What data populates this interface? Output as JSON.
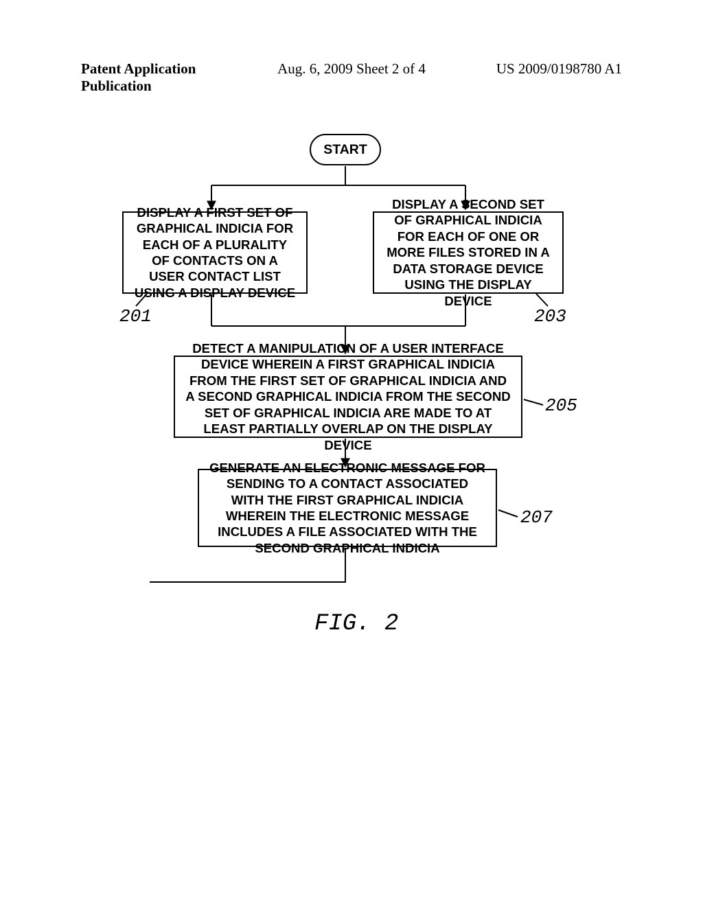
{
  "header": {
    "left": "Patent Application Publication",
    "mid_prefix": "Aug. 6, 2009   Sheet 2 of 4",
    "right": "US 2009/0198780 A1"
  },
  "start": {
    "label": "START"
  },
  "boxes": {
    "b201": "DISPLAY A FIRST SET OF GRAPHICAL INDICIA FOR EACH OF A PLURALITY OF CONTACTS ON A USER CONTACT LIST USING A DISPLAY DEVICE",
    "b203": "DISPLAY A SECOND SET OF GRAPHICAL INDICIA FOR EACH OF ONE OR MORE FILES STORED IN A DATA STORAGE DEVICE USING THE DISPLAY DEVICE",
    "b205": "DETECT A MANIPULATION OF A USER INTERFACE DEVICE WHEREIN A FIRST GRAPHICAL INDICIA FROM THE FIRST SET OF GRAPHICAL INDICIA AND A SECOND GRAPHICAL INDICIA FROM THE SECOND SET OF GRAPHICAL INDICIA ARE MADE TO AT LEAST PARTIALLY OVERLAP ON THE DISPLAY DEVICE",
    "b207": "GENERATE AN ELECTRONIC MESSAGE FOR SENDING TO A CONTACT ASSOCIATED WITH THE FIRST GRAPHICAL INDICIA WHEREIN THE ELECTRONIC MESSAGE INCLUDES A FILE ASSOCIATED WITH THE SECOND GRAPHICAL INDICIA"
  },
  "refs": {
    "r201": "201",
    "r203": "203",
    "r205": "205",
    "r207": "207"
  },
  "figure_label": "FIG. 2"
}
